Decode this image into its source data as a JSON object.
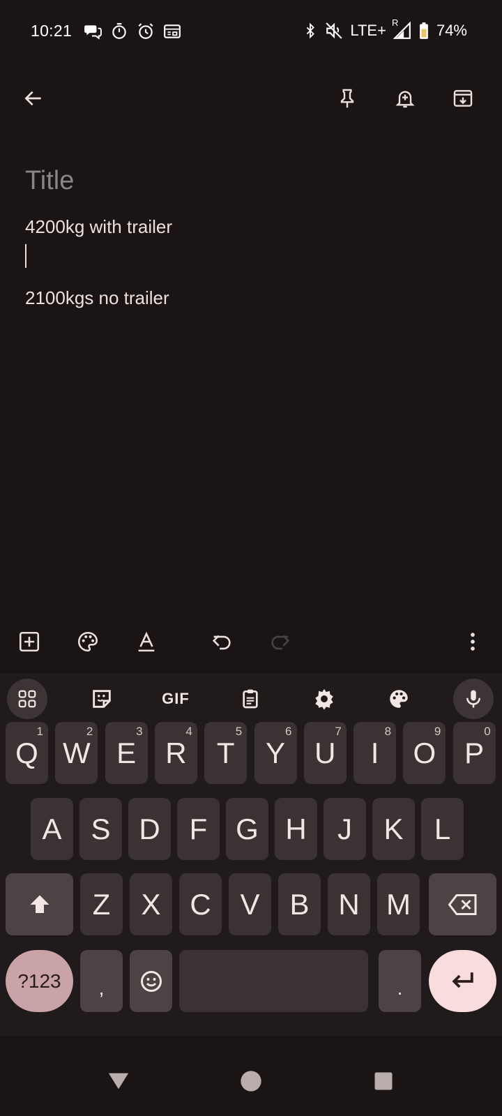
{
  "status": {
    "time": "10:21",
    "network": "LTE+",
    "roaming": "R",
    "battery": "74%"
  },
  "note": {
    "title_placeholder": "Title",
    "body": "4200kg with trailer\n\n\n2100kgs no trailer"
  },
  "keyboard": {
    "toolbar": {
      "gif_label": "GIF"
    },
    "row1": [
      {
        "label": "Q",
        "hint": "1"
      },
      {
        "label": "W",
        "hint": "2"
      },
      {
        "label": "E",
        "hint": "3"
      },
      {
        "label": "R",
        "hint": "4"
      },
      {
        "label": "T",
        "hint": "5"
      },
      {
        "label": "Y",
        "hint": "6"
      },
      {
        "label": "U",
        "hint": "7"
      },
      {
        "label": "I",
        "hint": "8"
      },
      {
        "label": "O",
        "hint": "9"
      },
      {
        "label": "P",
        "hint": "0"
      }
    ],
    "row2": [
      "A",
      "S",
      "D",
      "F",
      "G",
      "H",
      "J",
      "K",
      "L"
    ],
    "row3": [
      "Z",
      "X",
      "C",
      "V",
      "B",
      "N",
      "M"
    ],
    "symbols_label": "?123",
    "comma_label": ",",
    "period_label": "."
  },
  "colors": {
    "background": "#1a1415",
    "keyboard_bg": "#201a1b",
    "key_bg": "#3a3233",
    "symbols_key": "#c9a3a5",
    "enter_key": "#f9dcdc"
  }
}
